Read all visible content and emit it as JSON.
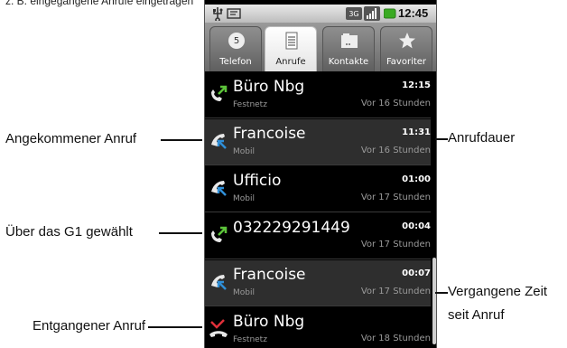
{
  "top_caption": "z. B. eingegangene Anrufe eingetragen",
  "statusbar": {
    "time": "12:45",
    "icons": [
      "usb-icon",
      "message-icon",
      "3g-icon",
      "signal-icon",
      "battery-icon"
    ]
  },
  "tabs": [
    {
      "label": "Telefon",
      "icon": "dialpad-icon",
      "active": false
    },
    {
      "label": "Anrufe",
      "icon": "call-log-icon",
      "active": true
    },
    {
      "label": "Kontakte",
      "icon": "contacts-icon",
      "active": false
    },
    {
      "label": "Favoriter",
      "icon": "star-icon",
      "active": false
    }
  ],
  "calls": [
    {
      "name": "Büro Nbg",
      "type": "Festnetz",
      "duration": "12:15",
      "ago": "Vor 16 Stunden",
      "kind": "outgoing"
    },
    {
      "name": "Francoise",
      "type": "Mobil",
      "duration": "11:31",
      "ago": "Vor 16 Stunden",
      "kind": "incoming"
    },
    {
      "name": "Ufficio",
      "type": "Mobil",
      "duration": "01:00",
      "ago": "Vor 17 Stunden",
      "kind": "incoming"
    },
    {
      "name": "032229291449",
      "type": "",
      "duration": "00:04",
      "ago": "Vor 17 Stunden",
      "kind": "outgoing"
    },
    {
      "name": "Francoise",
      "type": "Mobil",
      "duration": "00:07",
      "ago": "Vor 17 Stunden",
      "kind": "incoming"
    },
    {
      "name": "Büro Nbg",
      "type": "Festnetz",
      "duration": "",
      "ago": "Vor 18 Stunden",
      "kind": "missed"
    }
  ],
  "annotations": {
    "incoming": "Angekommener Anruf",
    "outgoing": "Über das G1 gewählt",
    "missed": "Entgangener Anruf",
    "duration": "Anrufdauer",
    "elapsed_line1": "Vergangene Zeit",
    "elapsed_line2": "seit Anruf"
  },
  "colors": {
    "incoming_arrow": "#2f8fd8",
    "outgoing_arrow": "#5cc23a",
    "missed_arrow": "#e0303a"
  }
}
